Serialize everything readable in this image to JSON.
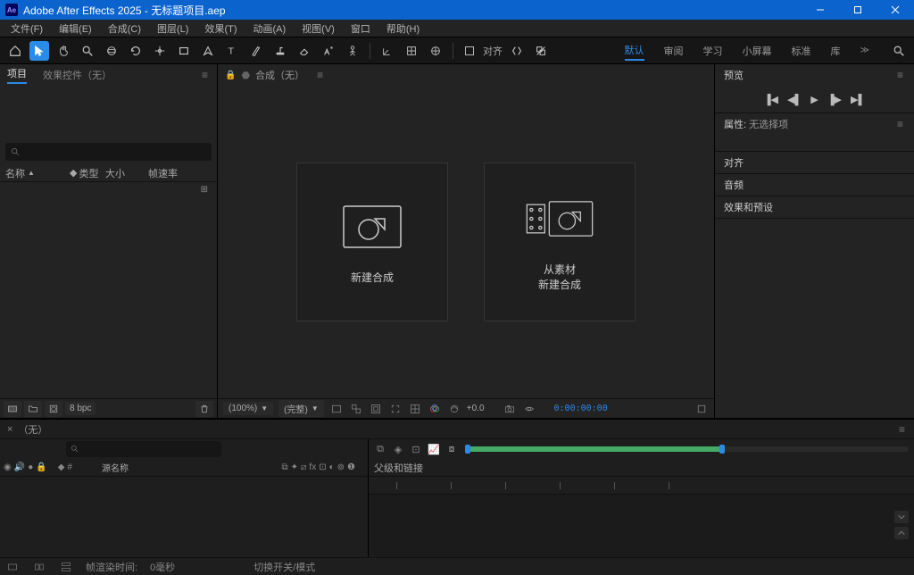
{
  "title": "Adobe After Effects 2025 - 无标题项目.aep",
  "menu": [
    "文件(F)",
    "编辑(E)",
    "合成(C)",
    "图层(L)",
    "效果(T)",
    "动画(A)",
    "视图(V)",
    "窗口",
    "帮助(H)"
  ],
  "toolbar": {
    "snap": "对齐"
  },
  "workspaces": [
    "默认",
    "审阅",
    "学习",
    "小屏幕",
    "标准",
    "库"
  ],
  "left": {
    "tab1": "项目",
    "tab2": "效果控件（无）",
    "cols": {
      "name": "名称",
      "type": "类型",
      "size": "大小",
      "fps": "帧速率"
    },
    "bpc": "8 bpc"
  },
  "center": {
    "header": "合成（无）",
    "card1": "新建合成",
    "card2_l1": "从素材",
    "card2_l2": "新建合成",
    "footer": {
      "zoom": "(100%)",
      "res": "(完整)",
      "exp": "+0.0",
      "tc": "0:00:00:00"
    }
  },
  "right": {
    "preview": "预览",
    "props": "属性:",
    "props_sub": "无选择项",
    "align": "对齐",
    "audio": "音频",
    "fx": "效果和预设"
  },
  "timeline": {
    "tab": "（无）",
    "source_col": "源名称",
    "parent_col": "父级和链接",
    "render_label": "帧渲染时间:",
    "render_val": "0毫秒",
    "switch_label": "切换开关/模式"
  }
}
